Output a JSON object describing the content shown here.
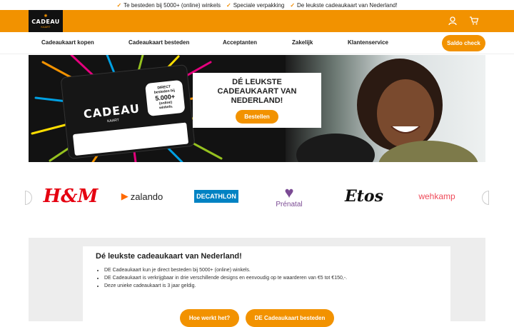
{
  "usps": [
    "Te besteden bij 5000+ (online) winkels",
    "Speciale verpakking",
    "De leukste cadeaukaart van Nederland!"
  ],
  "logo": {
    "line1": "CADEAU",
    "line2": "KAART"
  },
  "header_icons": [
    "user-icon",
    "cart-icon"
  ],
  "nav": {
    "items": [
      "Cadeaukaart kopen",
      "Cadeaukaart besteden",
      "Acceptanten",
      "Zakelijk",
      "Klantenservice"
    ],
    "saldo_label": "Saldo check"
  },
  "hero": {
    "card_brand": "CADEAU",
    "card_brand_sub": "KAART",
    "badge": {
      "line1": "DIRECT",
      "line2": "besteden bij",
      "line3": "5.000+",
      "line4": "(online)",
      "line5": "winkels."
    },
    "title_lines": [
      "DÉ LEUKSTE",
      "CADEAUKAART VAN",
      "NEDERLAND!"
    ],
    "cta": "Bestellen"
  },
  "brands": [
    "H&M",
    "zalando",
    "DECATHLON",
    "Prénatal",
    "Etos",
    "wehkamp"
  ],
  "info": {
    "title": "Dé leukste cadeaukaart van Nederland!",
    "bullets": [
      "DE Cadeaukaart kun je direct besteden bij 5000+ (online) winkels.",
      "DE Cadeaukaart is verkrijgbaar in drie verschillende designs en eenvoudig op te waarderen van €5 tot €150,-.",
      "Deze unieke cadeaukaart is 3 jaar geldig."
    ],
    "btn_how": "Hoe werkt het?",
    "btn_spend": "DE Cadeaukaart besteden"
  },
  "colors": {
    "accent": "#f29200",
    "dark": "#111111",
    "hm": "#e50010",
    "zalando": "#ff6900",
    "decathlon": "#0082c3",
    "prenatal": "#7b4b94",
    "wehkamp": "#ef4b5a"
  }
}
